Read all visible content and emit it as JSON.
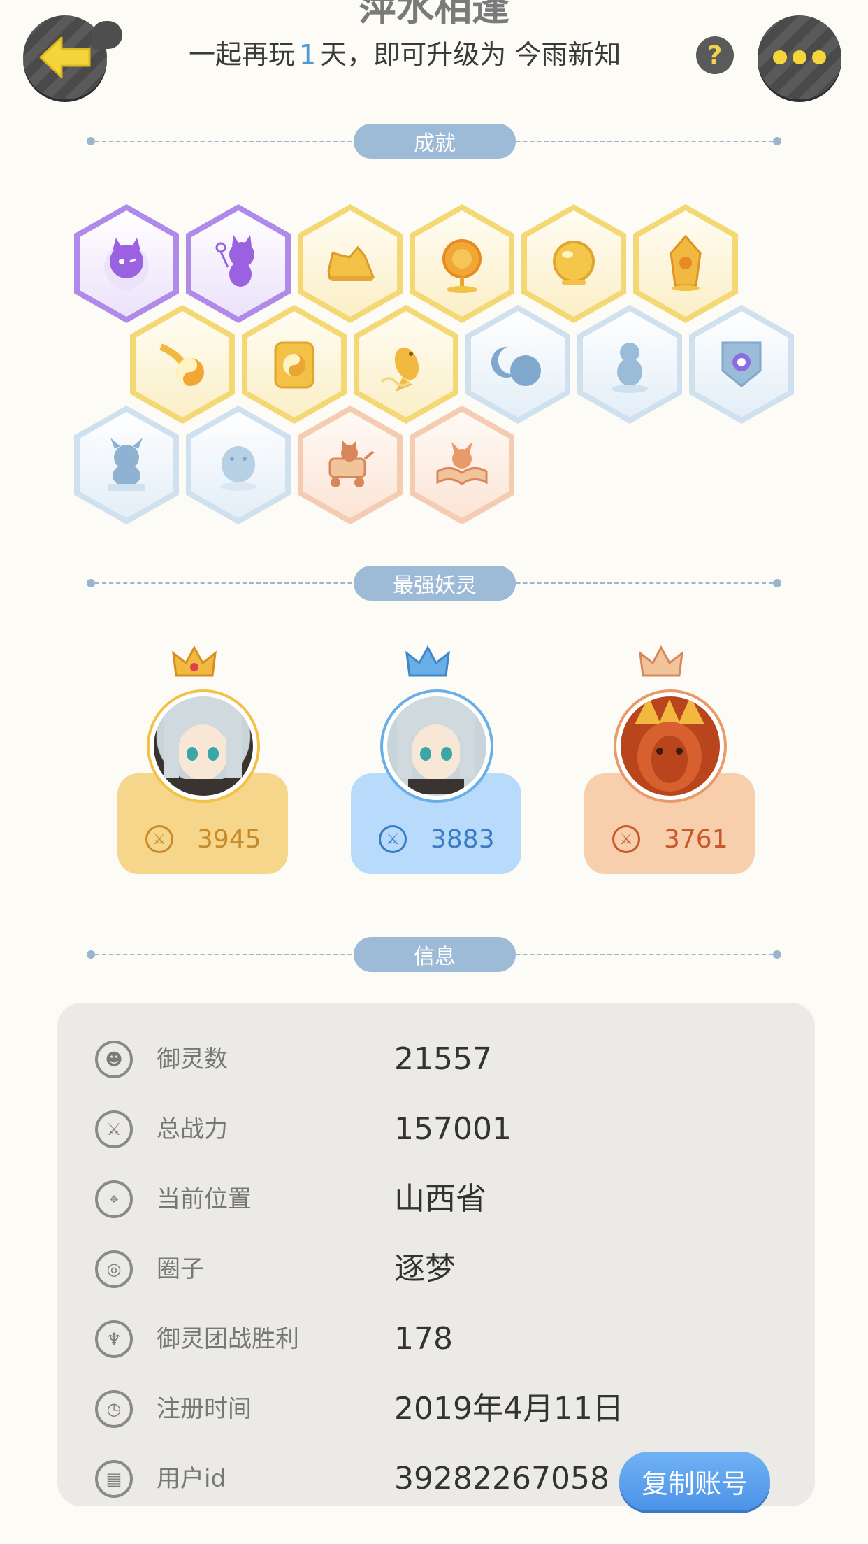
{
  "header": {
    "title": "萍水相逢",
    "prefix": "一起再玩",
    "days": "1",
    "suffix": "天，即可升级为",
    "next_level": "今雨新知",
    "help_label": "?"
  },
  "sections": {
    "achievements": "成就",
    "strongest": "最强妖灵",
    "info": "信息"
  },
  "achievements": [
    {
      "icon": "purple-cat-spirit-icon",
      "tier": "purple"
    },
    {
      "icon": "purple-dancing-cat-icon",
      "tier": "purple"
    },
    {
      "icon": "golden-sneaker-icon",
      "tier": "gold"
    },
    {
      "icon": "golden-sun-icon",
      "tier": "gold"
    },
    {
      "icon": "golden-orb-icon",
      "tier": "gold"
    },
    {
      "icon": "golden-crystal-icon",
      "tier": "gold"
    },
    {
      "icon": "golden-yinyang-fireball-icon",
      "tier": "gold"
    },
    {
      "icon": "golden-yinyang-tablet-icon",
      "tier": "gold"
    },
    {
      "icon": "golden-koi-fish-icon",
      "tier": "gold"
    },
    {
      "icon": "moon-eclipse-icon",
      "tier": "blue"
    },
    {
      "icon": "blue-spirit-statue-icon",
      "tier": "blue"
    },
    {
      "icon": "blue-shield-icon",
      "tier": "blue"
    },
    {
      "icon": "blue-demon-statue-icon",
      "tier": "blue"
    },
    {
      "icon": "blue-creature-icon",
      "tier": "blue"
    },
    {
      "icon": "cat-stroller-icon",
      "tier": "peach"
    },
    {
      "icon": "fox-book-icon",
      "tier": "peach"
    }
  ],
  "spirits": [
    {
      "power": "3945",
      "theme": "gold",
      "avatar": "silver-haired-girl-avatar"
    },
    {
      "power": "3883",
      "theme": "blue",
      "avatar": "silver-haired-girl-avatar"
    },
    {
      "power": "3761",
      "theme": "peach",
      "avatar": "fire-demon-avatar"
    }
  ],
  "info": [
    {
      "icon": "spirit-count-icon",
      "label": "御灵数",
      "value": "21557"
    },
    {
      "icon": "sword-icon",
      "label": "总战力",
      "value": "157001"
    },
    {
      "icon": "location-pin-icon",
      "label": "当前位置",
      "value": "山西省"
    },
    {
      "icon": "circle-group-icon",
      "label": "圈子",
      "value": "逐梦"
    },
    {
      "icon": "trophy-icon",
      "label": "御灵团战胜利",
      "value": "178"
    },
    {
      "icon": "clock-icon",
      "label": "注册时间",
      "value": "2019年4月11日"
    },
    {
      "icon": "id-card-icon",
      "label": "用户id",
      "value": "39282267058"
    }
  ],
  "copy_button": "复制账号",
  "colors": {
    "accent_blue": "#4a9ad6",
    "section_pill": "#9dbad6",
    "gold_card": "#f6d68a",
    "blue_card": "#b9dbfb",
    "peach_card": "#f7cfad"
  }
}
